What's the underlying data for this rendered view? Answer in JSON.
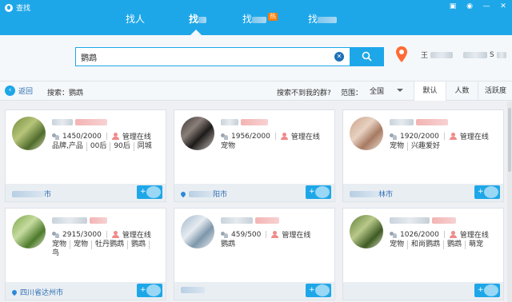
{
  "window": {
    "title": "查找",
    "controls": [
      "皮肤",
      "消息",
      "最小化",
      "关闭"
    ],
    "control_glyphs": [
      "▣",
      "◉",
      "—",
      "✕"
    ]
  },
  "tabs": [
    {
      "label": "找人",
      "active": false
    },
    {
      "label": "找",
      "active": true
    },
    {
      "label": "找",
      "badge": "热",
      "active": false
    },
    {
      "label": "找",
      "active": false
    }
  ],
  "search": {
    "value": "鹦鹉",
    "clear_glyph": "✕"
  },
  "location": {
    "user_prefix": "王",
    "suffix": "S"
  },
  "filterbar": {
    "back_label": "返回",
    "back_glyph": "‹",
    "breadcrumb": "搜索：鹦鹉",
    "not_found": "搜索不到我的群?",
    "scope_label": "范围：",
    "scope_value": "全国",
    "sort_tabs": [
      {
        "label": "默认",
        "active": true
      },
      {
        "label": "人数",
        "active": false
      },
      {
        "label": "活跃度",
        "active": false
      }
    ]
  },
  "cards": [
    {
      "members": "1450/2000",
      "admin": "管理在线",
      "tags": [
        "品牌,产品",
        "00后",
        "90后",
        "同城"
      ],
      "location": "市",
      "add_label": "+"
    },
    {
      "members": "1956/2000",
      "admin": "管理在线",
      "tags": [
        "宠物"
      ],
      "location": "阳市",
      "add_label": "+"
    },
    {
      "members": "1920/2000",
      "admin": "管理在线",
      "tags": [
        "宠物",
        "兴趣爱好"
      ],
      "location": "林市",
      "add_label": "+"
    },
    {
      "members": "2915/3000",
      "admin": "管理在线",
      "tags": [
        "宠物",
        "宠物",
        "牡丹鹦鹉",
        "鹦鹉",
        "鸟"
      ],
      "location": "四川省达州市",
      "add_label": "+"
    },
    {
      "members": "459/500",
      "admin": "管理在线",
      "tags": [
        "鹦鹉"
      ],
      "location": "",
      "add_label": "+"
    },
    {
      "members": "1026/2000",
      "admin": "管理在线",
      "tags": [
        "宠物",
        "和尚鹦鹉",
        "鹦鹉",
        "萌宠"
      ],
      "location": "",
      "add_label": "+"
    }
  ],
  "colors": {
    "accent": "#1ea7e8",
    "link": "#2b6cb0",
    "hot": "#ff7a00"
  }
}
